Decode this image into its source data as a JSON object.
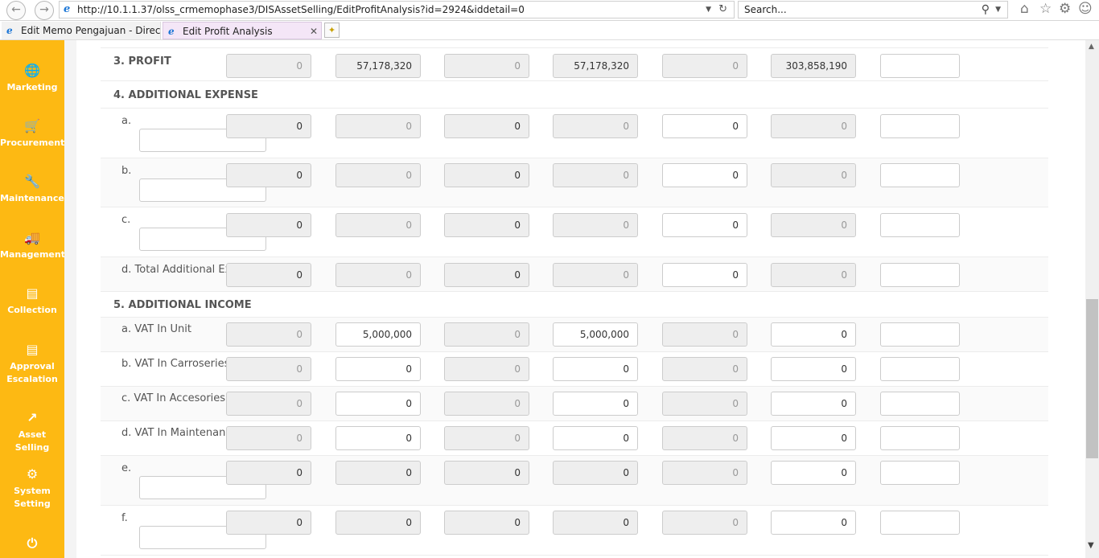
{
  "browser": {
    "url": "http://10.1.1.37/olss_crmemophase3/DISAssetSelling/EditProfitAnalysis?id=2924&iddetail=0",
    "search_placeholder": "Search...",
    "tabs": [
      {
        "label": "Edit Memo Pengajuan - Direct ..."
      },
      {
        "label": "Edit Profit Analysis"
      }
    ]
  },
  "sidebar": {
    "items": [
      {
        "label": "Marketing",
        "icon": "globe-icon"
      },
      {
        "label": "Procurement",
        "icon": "cart-icon"
      },
      {
        "label": "Maintenance",
        "icon": "wrench-icon"
      },
      {
        "label": "Management",
        "icon": "truck-icon"
      },
      {
        "label": "Collection",
        "icon": "list-icon"
      },
      {
        "label": "Approval Escalation",
        "icon": "list-icon"
      },
      {
        "label": "Asset Selling",
        "icon": "external-link-icon"
      },
      {
        "label": "System Setting",
        "icon": "gear-icon"
      }
    ],
    "power_icon": "power-icon"
  },
  "profit": {
    "label": "3. PROFIT",
    "values": [
      "0",
      "57,178,320",
      "0",
      "57,178,320",
      "0",
      "303,858,190",
      ""
    ]
  },
  "additional_expense": {
    "label": "4. ADDITIONAL EXPENSE",
    "rows": [
      {
        "label": "a.",
        "values": [
          "0",
          "0",
          "0",
          "0",
          "0",
          "0",
          ""
        ]
      },
      {
        "label": "b.",
        "values": [
          "0",
          "0",
          "0",
          "0",
          "0",
          "0",
          ""
        ]
      },
      {
        "label": "c.",
        "values": [
          "0",
          "0",
          "0",
          "0",
          "0",
          "0",
          ""
        ]
      },
      {
        "label": "d. Total Additional Expense",
        "values": [
          "0",
          "0",
          "0",
          "0",
          "0",
          "0",
          ""
        ]
      }
    ]
  },
  "additional_income": {
    "label": "5. ADDITIONAL INCOME",
    "rows": [
      {
        "label": "a. VAT In Unit",
        "values": [
          "0",
          "5,000,000",
          "0",
          "5,000,000",
          "0",
          "0",
          ""
        ]
      },
      {
        "label": "b. VAT In Carroseries",
        "values": [
          "0",
          "0",
          "0",
          "0",
          "0",
          "0",
          ""
        ]
      },
      {
        "label": "c. VAT In Accesories",
        "values": [
          "0",
          "0",
          "0",
          "0",
          "0",
          "0",
          ""
        ]
      },
      {
        "label": "d. VAT In Maintenance",
        "values": [
          "0",
          "0",
          "0",
          "0",
          "0",
          "0",
          ""
        ]
      },
      {
        "label": "e.",
        "values": [
          "0",
          "0",
          "0",
          "0",
          "0",
          "0",
          ""
        ]
      },
      {
        "label": "f.",
        "values": [
          "0",
          "0",
          "0",
          "0",
          "0",
          "0",
          ""
        ]
      }
    ]
  }
}
